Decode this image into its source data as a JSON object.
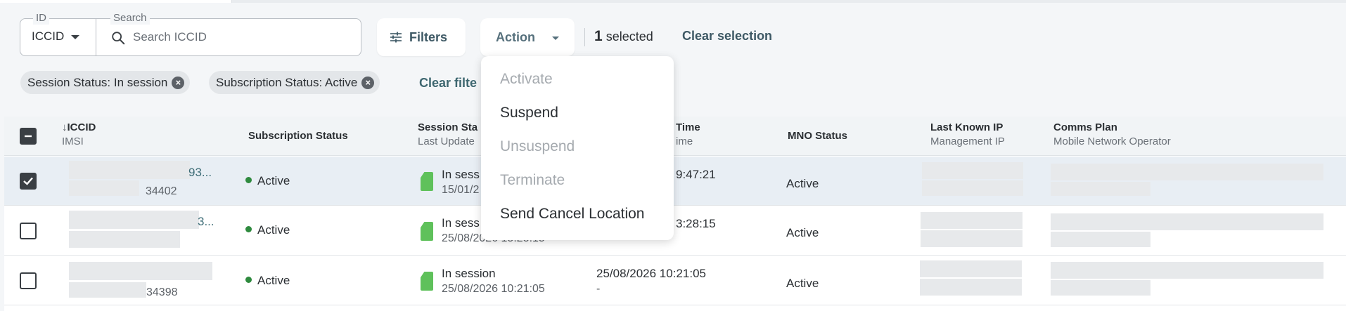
{
  "search": {
    "id_legend": "ID",
    "id_value": "ICCID",
    "search_legend": "Search",
    "placeholder": "Search ICCID"
  },
  "toolbar": {
    "filters_label": "Filters",
    "action_label": "Action",
    "selected_count": "1",
    "selected_text": "selected",
    "clear_selection": "Clear selection"
  },
  "chips": [
    {
      "label": "Session Status: In session"
    },
    {
      "label": "Subscription Status: Active"
    }
  ],
  "clear_filters": "Clear filte",
  "action_menu": {
    "items": [
      {
        "label": "Activate",
        "enabled": false
      },
      {
        "label": "Suspend",
        "enabled": true
      },
      {
        "label": "Unsuspend",
        "enabled": false
      },
      {
        "label": "Terminate",
        "enabled": false
      },
      {
        "label": "Send Cancel Location",
        "enabled": true
      }
    ]
  },
  "table": {
    "columns": {
      "iccid": "ICCID",
      "imsi": "IMSI",
      "subscription_status": "Subscription Status",
      "session_status": "Session Sta",
      "last_update": "Last Update",
      "time": "Time",
      "time_sub": "ime",
      "mno_status": "MNO Status",
      "last_known_ip": "Last Known IP",
      "management_ip": "Management IP",
      "comms_plan": "Comms Plan",
      "mobile_network_operator": "Mobile Network Operator"
    },
    "rows": [
      {
        "checked": true,
        "iccid_tail": "93...",
        "imsi_tail": "34402",
        "subscription_status": "Active",
        "session": "In sess",
        "session_time": "15/01/2",
        "time": "9:47:21",
        "time_sub": "",
        "mno_status": "Active"
      },
      {
        "checked": false,
        "iccid_tail": "3...",
        "imsi_tail": "",
        "subscription_status": "Active",
        "session": "In sess",
        "session_time": "25/08/2026 15:28:15",
        "time": "3:28:15",
        "time_sub": "",
        "mno_status": "Active"
      },
      {
        "checked": false,
        "iccid_tail": "",
        "imsi_tail": "34398",
        "subscription_status": "Active",
        "session": "In session",
        "session_time": "25/08/2026 10:21:05",
        "time": "25/08/2026 10:21:05",
        "time_sub": "-",
        "mno_status": "Active"
      }
    ]
  },
  "colors": {
    "status_active": "#2e8a3e",
    "sim_icon": "#5fc15b",
    "link": "#3e5965",
    "selected_row": "#e8eef4"
  }
}
